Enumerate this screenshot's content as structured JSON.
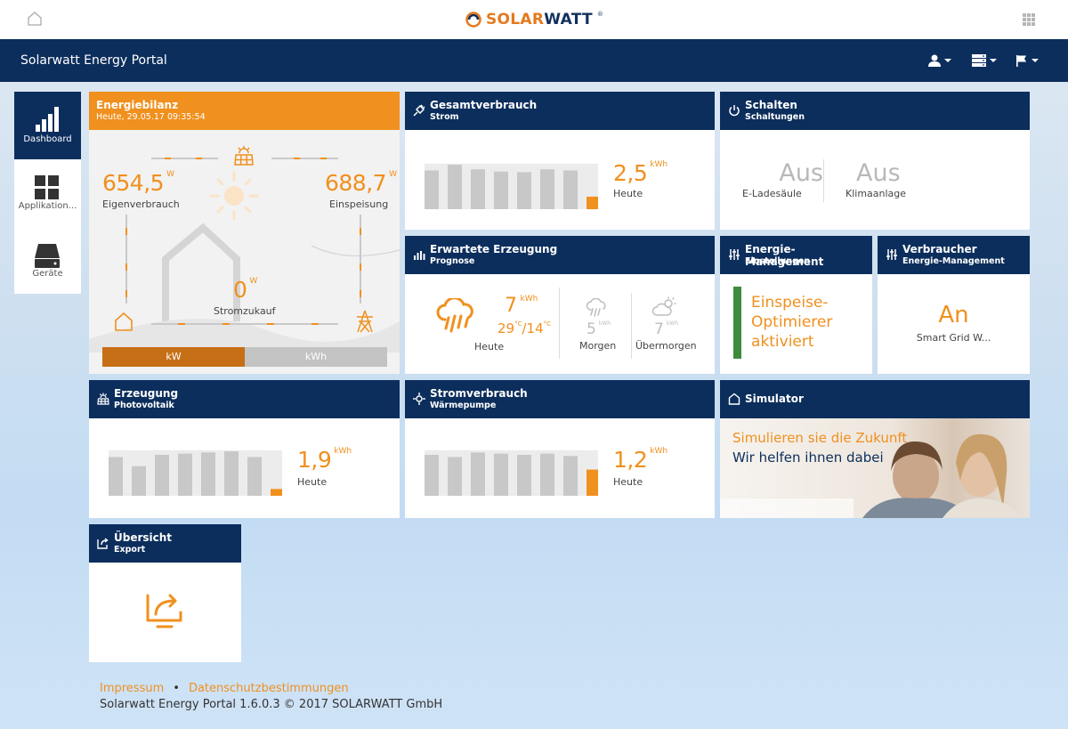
{
  "brand": {
    "logo_text_orange": "SOLAR",
    "logo_text_blue": "WATT",
    "logo_reg": "®",
    "accent": "#f0901e",
    "navy": "#0c2e5c"
  },
  "navbar": {
    "title": "Solarwatt Energy Portal",
    "menus": [
      "user-icon",
      "server-icon",
      "flag-icon"
    ]
  },
  "sidebar": {
    "items": [
      {
        "label": "Dashboard",
        "icon": "signal-bars-icon",
        "active": true
      },
      {
        "label": "Applikation...",
        "icon": "grid-icon",
        "active": false
      },
      {
        "label": "Geräte",
        "icon": "device-icon",
        "active": false
      }
    ]
  },
  "energiebilanz": {
    "title": "Energiebilanz",
    "subtitle": "Heute, 29.05.17 09:35:54",
    "eigen_value": "654,5",
    "eigen_unit": "W",
    "eigen_label": "Eigenverbrauch",
    "einsp_value": "688,7",
    "einsp_unit": "W",
    "einsp_label": "Einspeisung",
    "zukauf_value": "0",
    "zukauf_unit": "W",
    "zukauf_label": "Stromzukauf",
    "toggle": [
      "kW",
      "kWh"
    ],
    "toggle_active": "kW"
  },
  "gesamtverbrauch": {
    "title": "Gesamtverbrauch",
    "subtitle": "Strom",
    "value": "2,5",
    "unit": "kWh",
    "label": "Heute",
    "bars": [
      0.68,
      0.78,
      0.7,
      0.66,
      0.65,
      0.7,
      0.68,
      0.22
    ]
  },
  "schalten": {
    "title": "Schalten",
    "subtitle": "Schaltungen",
    "items": [
      {
        "state": "Aus",
        "label": "E-Ladesäule"
      },
      {
        "state": "Aus",
        "label": "Klimaanlage"
      }
    ]
  },
  "erzeugung_prognose": {
    "title": "Erwartete Erzeugung",
    "subtitle": "Prognose",
    "today": {
      "value": "7",
      "unit": "kWh",
      "temp_max": "29",
      "temp_min": "14",
      "temp_unit": "°C",
      "label": "Heute"
    },
    "tomorrow": {
      "value": "5",
      "unit": "kWh",
      "label": "Morgen"
    },
    "after": {
      "value": "7",
      "unit": "kWh",
      "label": "Übermorgen"
    }
  },
  "energie_management": {
    "title": "Energie-Management",
    "subtitle": "Einstellungen",
    "line1": "Einspeise-",
    "line2": "Optimierer",
    "line3": "aktiviert",
    "status_color": "#3c8c3c"
  },
  "verbraucher": {
    "title": "Verbraucher",
    "subtitle": "Energie-Management",
    "state": "An",
    "label": "Smart Grid W..."
  },
  "erzeugung_pv": {
    "title": "Erzeugung",
    "subtitle": "Photovoltaik",
    "value": "1,9",
    "unit": "kWh",
    "label": "Heute",
    "bars": [
      0.68,
      0.52,
      0.72,
      0.74,
      0.76,
      0.78,
      0.68,
      0.12
    ]
  },
  "stromverbrauch": {
    "title": "Stromverbrauch",
    "subtitle": "Wärmepumpe",
    "value": "1,2",
    "unit": "kWh",
    "label": "Heute",
    "bars": [
      0.72,
      0.68,
      0.76,
      0.74,
      0.72,
      0.74,
      0.7,
      0.46
    ]
  },
  "simulator": {
    "title": "Simulator",
    "line1": "Simulieren sie die Zukunft",
    "line2": "Wir helfen ihnen dabei"
  },
  "uebersicht": {
    "title": "Übersicht",
    "subtitle": "Export"
  },
  "footer": {
    "impressum": "Impressum",
    "datenschutz": "Datenschutzbestimmungen",
    "separator": "•",
    "copyright": "Solarwatt Energy Portal 1.6.0.3 © 2017 SOLARWATT GmbH"
  }
}
